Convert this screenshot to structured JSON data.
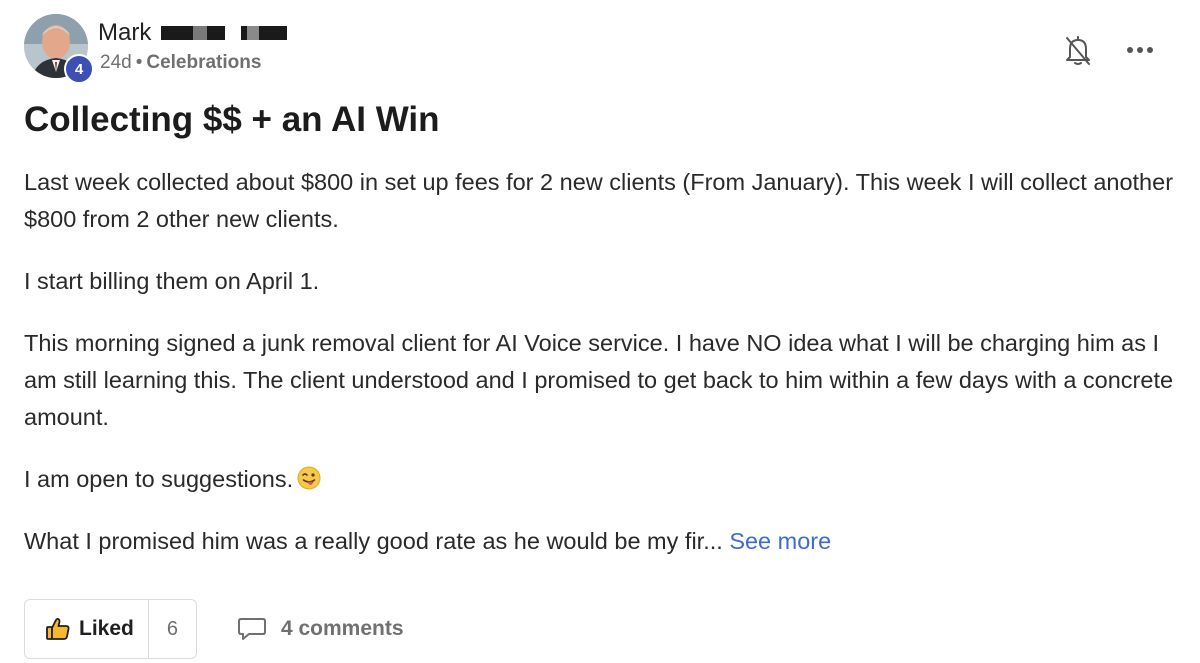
{
  "post": {
    "author": {
      "name": "Mark",
      "level": "4",
      "avatar_icon": "user-avatar-photo"
    },
    "age": "24d",
    "separator": "•",
    "category": "Celebrations",
    "title": "Collecting $$ + an AI Win",
    "paragraphs": [
      "Last week collected about $800 in set up fees for 2 new clients (From January). This week I will collect another $800 from 2 other new clients.",
      "I start billing them on April 1.",
      "This morning signed a junk removal client for AI Voice service. I have NO idea what I will be charging him as I am still learning this. The client understood and I promised to get back to him within a few days with a concrete amount.",
      "I am open to suggestions.",
      "What I promised him was a really good rate as he would be my fir..."
    ],
    "emoji": "winking-face-with-tongue",
    "see_more": "See more"
  },
  "actions": {
    "bell_icon": "bell-off-icon",
    "more_icon": "more-horizontal-icon"
  },
  "footer": {
    "like_label": "Liked",
    "like_count": "6",
    "comments_label": "4 comments"
  },
  "colors": {
    "level_badge": "#3c4fb5",
    "link": "#3d6bd6",
    "muted": "#707070"
  }
}
